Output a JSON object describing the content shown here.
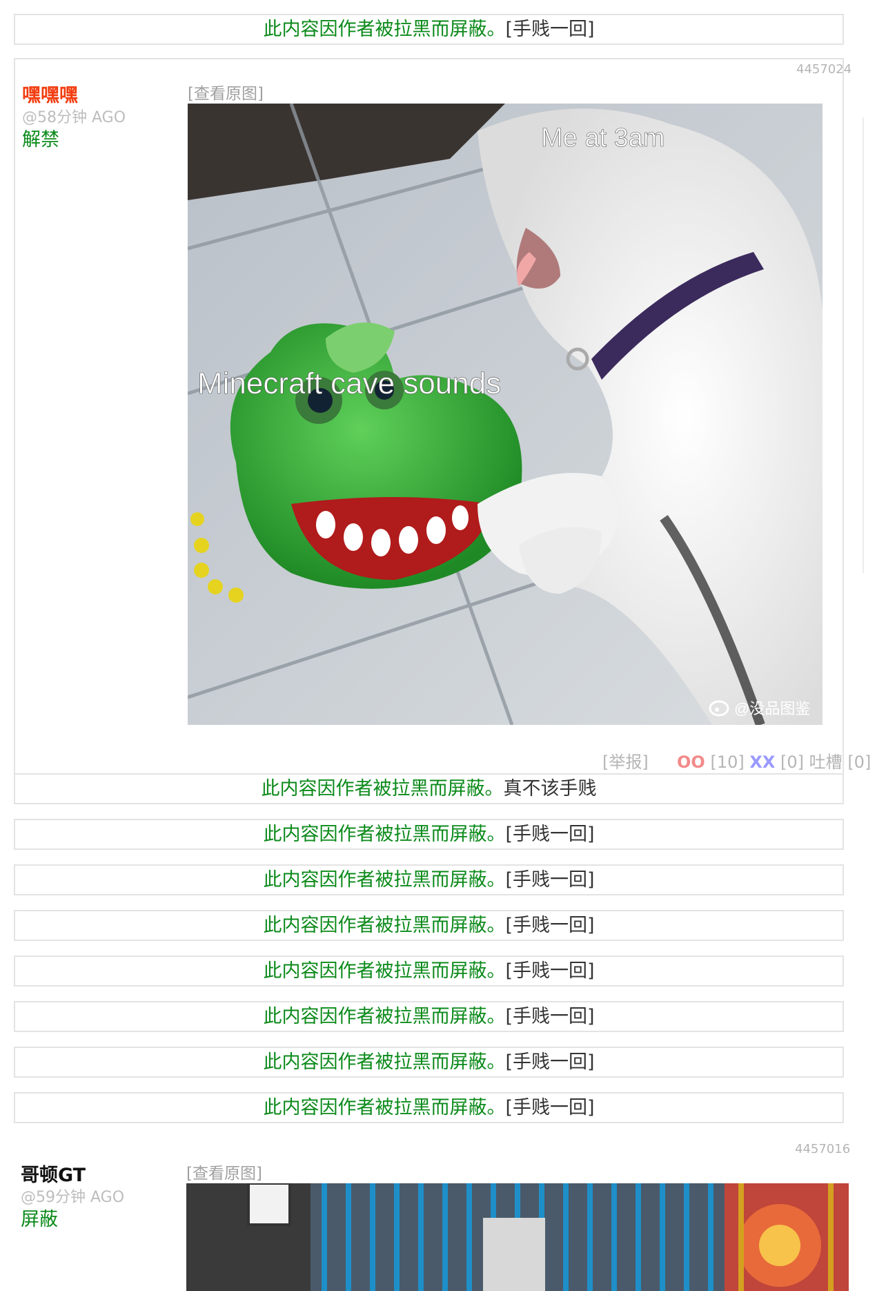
{
  "blocked_text": "此内容因作者被拉黑而屏蔽。",
  "blocked_action": "[手贱一回]",
  "blocked_action_alt": "真不该手贱",
  "post1": {
    "id": "4457024",
    "author": "嘿嘿嘿",
    "time": "@58分钟 AGO",
    "mod_action": "解禁",
    "view_original": "[查看原图]",
    "meme_text_top": "Me at 3am",
    "meme_text_mid": "Minecraft cave sounds",
    "watermark": "@没品图鉴",
    "report": "[举报]",
    "oo_label": "OO",
    "oo_count": "[10]",
    "xx_label": "XX",
    "xx_count": "[0]",
    "comment_label": "吐槽",
    "comment_count": "[0]"
  },
  "post2": {
    "id": "4457016",
    "author": "哥顿GT",
    "time": "@59分钟 AGO",
    "mod_action": "屏蔽",
    "view_original": "[查看原图]"
  }
}
